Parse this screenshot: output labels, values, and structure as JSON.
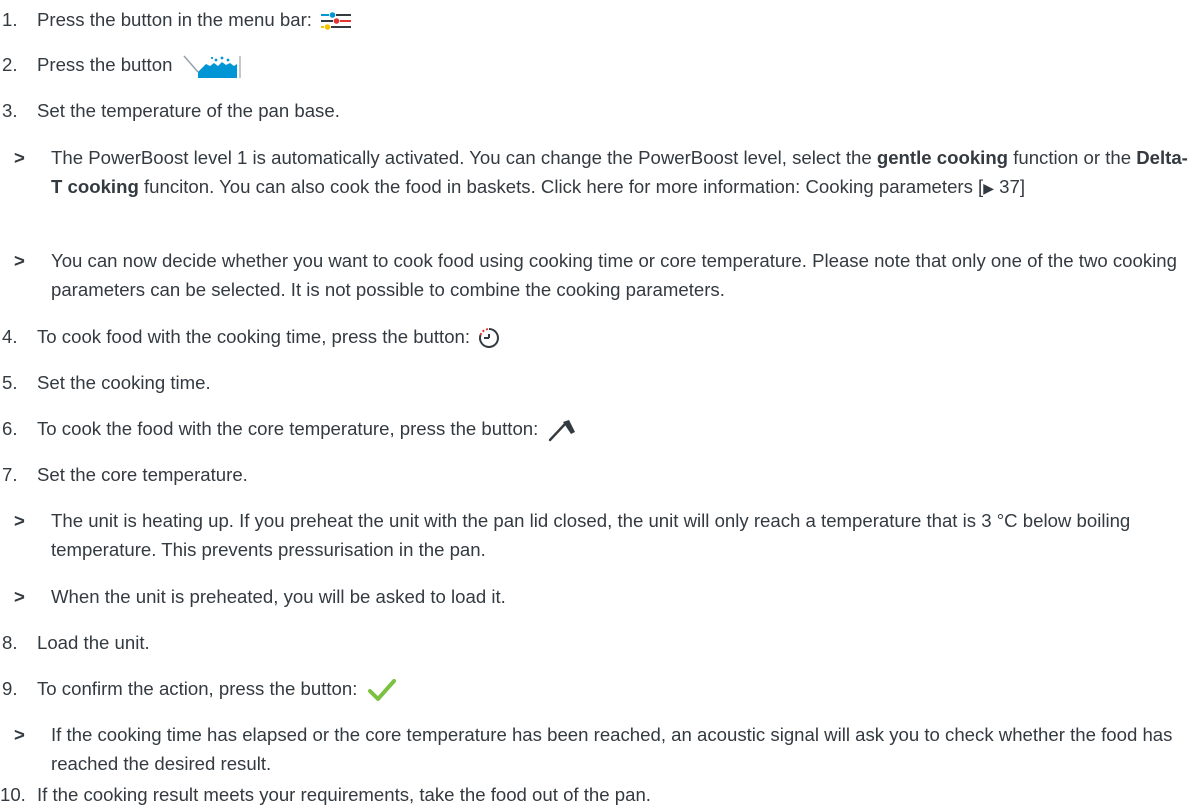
{
  "steps": [
    {
      "n": "1.",
      "text": "Press the button in the menu bar:",
      "icon": "settings-sliders-icon"
    },
    {
      "n": "2.",
      "text": "Press the button",
      "icon": "pan-cooking-icon"
    },
    {
      "n": "3.",
      "text": "Set the temperature of the pan base."
    },
    {
      "type": "result",
      "marker": ">",
      "parts": [
        "The PowerBoost level 1 is automatically activated. You can change the PowerBoost level, select the ",
        "gentle cooking",
        " function or the ",
        "Delta-T cooking",
        " funciton. You can also cook the food in baskets. Click here for more information: ",
        "Cooking parameters [",
        "▶",
        " 37]"
      ]
    },
    {
      "type": "result",
      "marker": ">",
      "text": "You can now decide whether you want to cook food using cooking time or core temperature. Please note that only one of the two cooking parameters can be selected. It is not possible to combine the cooking parameters."
    },
    {
      "n": "4.",
      "text": "To cook food with the cooking time, press the button:",
      "icon": "timer-icon"
    },
    {
      "n": "5.",
      "text": "Set the cooking time."
    },
    {
      "n": "6.",
      "text": "To cook the food with the core temperature, press the button:",
      "icon": "core-probe-icon"
    },
    {
      "n": "7.",
      "text": "Set the core temperature."
    },
    {
      "type": "result",
      "marker": ">",
      "text": "The unit is heating up. If you preheat the unit with the pan lid closed, the unit will only reach a temperature that is 3 °C below boiling temperature. This prevents pressurisation in the pan."
    },
    {
      "type": "result",
      "marker": ">",
      "text": "When the unit is preheated, you will be asked to load it."
    },
    {
      "n": "8.",
      "text": "Load the unit."
    },
    {
      "n": "9.",
      "text": "To confirm the action, press the button:",
      "icon": "checkmark-icon"
    },
    {
      "type": "result",
      "marker": ">",
      "text": "If the cooking time has elapsed or the core temperature has been reached, an acoustic signal will ask you to check whether the food has reached the desired result."
    },
    {
      "n": "10.",
      "text": "If the cooking result meets your requirements, take the food out of the pan."
    }
  ],
  "colors": {
    "text": "#333a40",
    "checkmark": "#7cc242",
    "accent_blue": "#0096d6",
    "accent_red": "#e3342f",
    "accent_yellow": "#f5c400"
  }
}
